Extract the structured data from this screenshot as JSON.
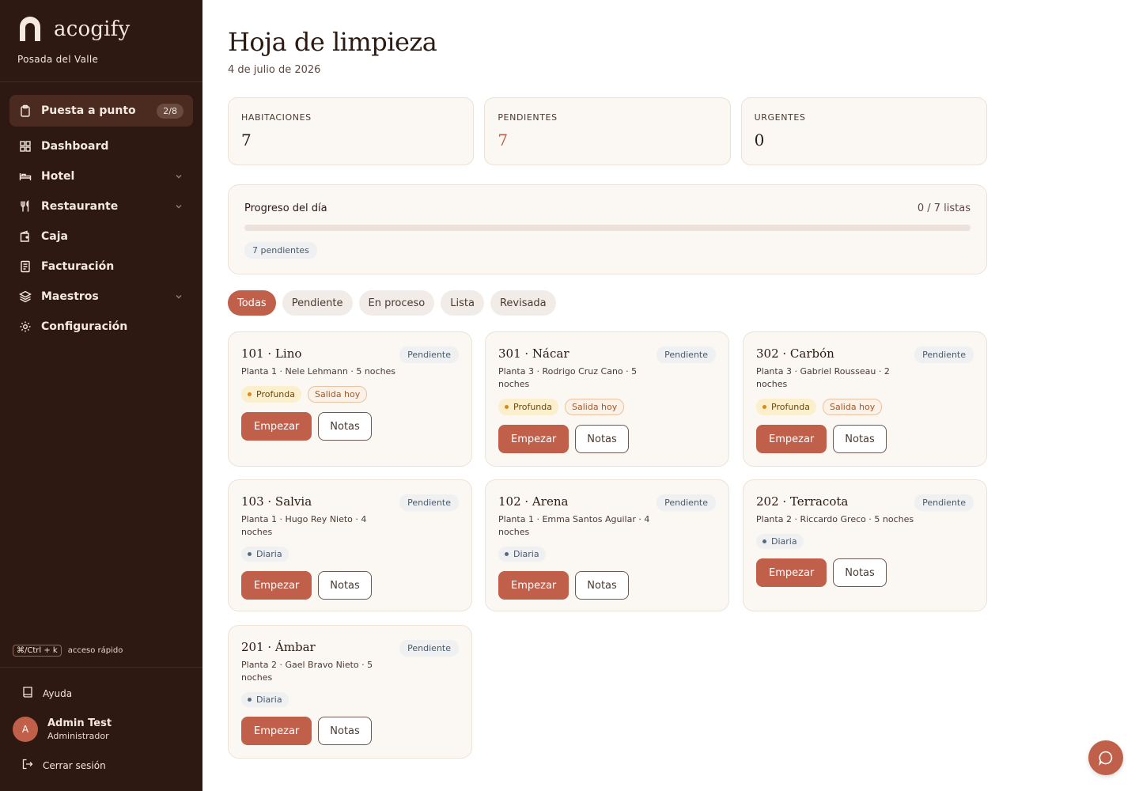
{
  "brand": {
    "name": "acogify",
    "hotel": "Posada del Valle",
    "logo_icon": "arch-logo"
  },
  "nav": {
    "items": [
      {
        "label": "Puesta a punto",
        "icon": "clipboard-icon",
        "badge": "2/8",
        "active": true
      },
      {
        "label": "Dashboard",
        "icon": "grid-icon"
      },
      {
        "label": "Hotel",
        "icon": "bed-icon",
        "expandable": true
      },
      {
        "label": "Restaurante",
        "icon": "utensils-icon",
        "expandable": true
      },
      {
        "label": "Caja",
        "icon": "wallet-icon"
      },
      {
        "label": "Facturación",
        "icon": "receipt-icon"
      },
      {
        "label": "Maestros",
        "icon": "layers-icon",
        "expandable": true
      },
      {
        "label": "Configuración",
        "icon": "gear-icon"
      }
    ]
  },
  "shortcut": {
    "keys": "⌘/Ctrl + k",
    "label": "acceso rápido"
  },
  "footer": {
    "help": "Ayuda",
    "user": {
      "initial": "A",
      "name": "Admin Test",
      "role": "Administrador"
    },
    "logout": "Cerrar sesión"
  },
  "page": {
    "title": "Hoja de limpieza",
    "date": "4 de julio de 2026"
  },
  "stats": [
    {
      "label": "HABITACIONES",
      "value": "7"
    },
    {
      "label": "PENDIENTES",
      "value": "7"
    },
    {
      "label": "URGENTES",
      "value": "0"
    }
  ],
  "progress": {
    "title": "Progreso del día",
    "count": "0 / 7 listas",
    "fraction": 0,
    "pending_chip": "7 pendientes"
  },
  "filters": [
    "Todas",
    "Pendiente",
    "En proceso",
    "Lista",
    "Revisada"
  ],
  "rooms": [
    {
      "title": "101 · Lino",
      "status": "Pendiente",
      "meta": "Planta 1 · Nele Lehmann · 5 noches",
      "tags": [
        "Profunda",
        "Salida hoy"
      ]
    },
    {
      "title": "301 · Nácar",
      "status": "Pendiente",
      "meta": "Planta 3 · Rodrigo Cruz Cano · 5 noches",
      "tags": [
        "Profunda",
        "Salida hoy"
      ]
    },
    {
      "title": "302 · Carbón",
      "status": "Pendiente",
      "meta": "Planta 3 · Gabriel Rousseau · 2 noches",
      "tags": [
        "Profunda",
        "Salida hoy"
      ]
    },
    {
      "title": "103 · Salvia",
      "status": "Pendiente",
      "meta": "Planta 1 · Hugo Rey Nieto · 4 noches",
      "tags": [
        "Diaria"
      ]
    },
    {
      "title": "102 · Arena",
      "status": "Pendiente",
      "meta": "Planta 1 · Emma Santos Aguilar · 4 noches",
      "tags": [
        "Diaria"
      ]
    },
    {
      "title": "202 · Terracota",
      "status": "Pendiente",
      "meta": "Planta 2 · Riccardo Greco · 5 noches",
      "tags": [
        "Diaria"
      ]
    },
    {
      "title": "201 · Ámbar",
      "status": "Pendiente",
      "meta": "Planta 2 · Gael Bravo Nieto · 5 noches",
      "tags": [
        "Diaria"
      ]
    }
  ],
  "actions": {
    "start": "Empezar",
    "notes": "Notas"
  },
  "colors": {
    "sidebar": "#2d1912",
    "accent": "#c0604a",
    "card": "#fbf7f2"
  }
}
